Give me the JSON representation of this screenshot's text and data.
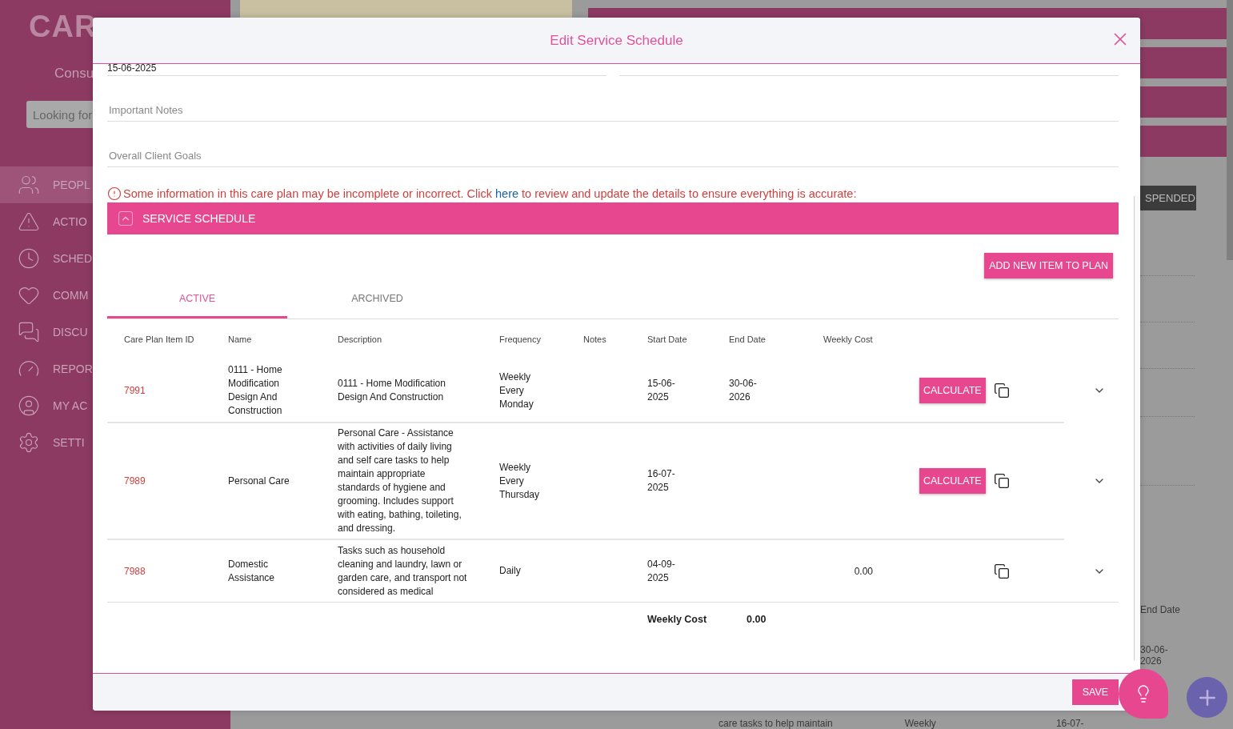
{
  "sidebar": {
    "logo": "CAR",
    "subtitle": "Consu",
    "search": {
      "placeholder": "Looking for"
    },
    "items": [
      {
        "label": "PEOPL",
        "selected": true
      },
      {
        "label": "ACTIO",
        "selected": false
      },
      {
        "label": "SCHED",
        "selected": false
      },
      {
        "label": "COMM",
        "selected": false
      },
      {
        "label": "DISCU",
        "selected": false
      },
      {
        "label": "REPOR",
        "selected": false
      },
      {
        "label": "MY AC",
        "selected": false
      },
      {
        "label": "SETTI",
        "selected": false
      }
    ]
  },
  "background": {
    "badge": "SPENDED",
    "end_date_header": "End Date",
    "end_date": "30-06-2026",
    "bottom_description": "care tasks to help maintain",
    "bottom_frequency": "Weekly",
    "bottom_start": "16-07-"
  },
  "modal": {
    "title": "Edit Service Schedule",
    "date_value": "15-06-2025",
    "fields": [
      {
        "placeholder": "Important Notes"
      },
      {
        "placeholder": "Overall Client Goals"
      }
    ],
    "warning": {
      "before": "Some information in this care plan may be incomplete or incorrect. Click",
      "link": "here",
      "after": "to review and update the details to ensure everything is accurate:"
    },
    "section": {
      "title": "SERVICE SCHEDULE",
      "expanded": true
    },
    "add_button": "ADD NEW ITEM TO PLAN",
    "tabs": [
      {
        "label": "ACTIVE",
        "selected": true
      },
      {
        "label": "ARCHIVED",
        "selected": false
      }
    ],
    "columns": [
      "Care Plan Item ID",
      "Name",
      "Description",
      "Frequency",
      "Notes",
      "Start Date",
      "End Date",
      "Weekly Cost"
    ],
    "rows": [
      {
        "kind": "calculate",
        "id": "7991",
        "name": "0111 - Home Modification Design And Construction",
        "description": "0111 - Home Modification Design And Construction",
        "frequency": "Weekly Every Monday",
        "start": "15-06-2025",
        "end": "30-06-2026",
        "action": "CALCULATE",
        "expanded": false
      },
      {
        "kind": "calculate",
        "id": "7989",
        "name": "Personal Care",
        "description": "Personal Care - Assistance with activities of daily living and self care tasks to help maintain appropriate standards of hygiene and grooming. Includes support with eating, bathing, toileting, and dressing.",
        "frequency": "Weekly Every Thursday",
        "start": "16-07-2025",
        "action": "CALCULATE",
        "expanded": false
      },
      {
        "kind": "cost",
        "id": "7988",
        "name": "Domestic Assistance",
        "description": "Tasks such as household cleaning and laundry, lawn or garden care, and transport not considered as medical",
        "frequency": "Daily",
        "start": "04-09-2025",
        "weekly_cost": "0.00",
        "expanded": false
      }
    ],
    "total": {
      "label": "Weekly Cost",
      "value": "0.00"
    },
    "save": "SAVE"
  }
}
